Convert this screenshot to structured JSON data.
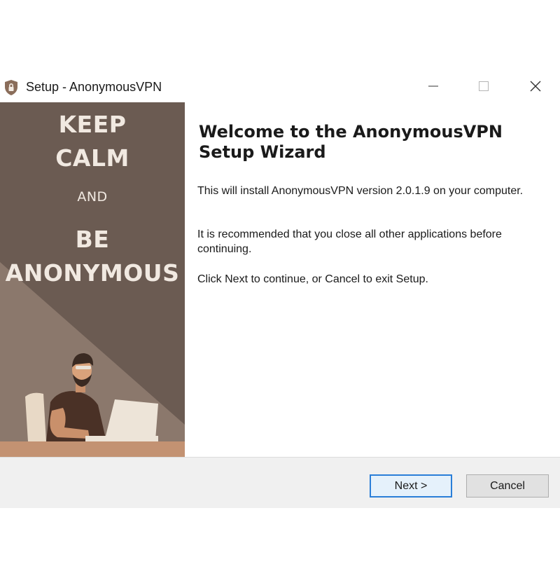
{
  "window": {
    "title": "Setup - AnonymousVPN",
    "controls": {
      "minimize_icon": "minimize-icon",
      "maximize_icon": "maximize-icon",
      "close_icon": "close-icon"
    }
  },
  "banner": {
    "lines": [
      "KEEP",
      "CALM",
      "AND",
      "BE",
      "ANONYMOUS"
    ],
    "colors": {
      "background": "#6b5b52",
      "text": "#f1e9e1",
      "floor": "#c39272"
    }
  },
  "content": {
    "heading": "Welcome to the AnonymousVPN\nSetup Wizard",
    "paragraphs": [
      "This will install AnonymousVPN version 2.0.1.9 on your computer.",
      "It is recommended that you close all other applications before continuing.",
      "Click Next to continue, or Cancel to exit Setup."
    ]
  },
  "footer": {
    "next_label": "Next >",
    "cancel_label": "Cancel"
  },
  "colors": {
    "accent": "#2a7ed8",
    "footer_bg": "#f0f0f0"
  }
}
